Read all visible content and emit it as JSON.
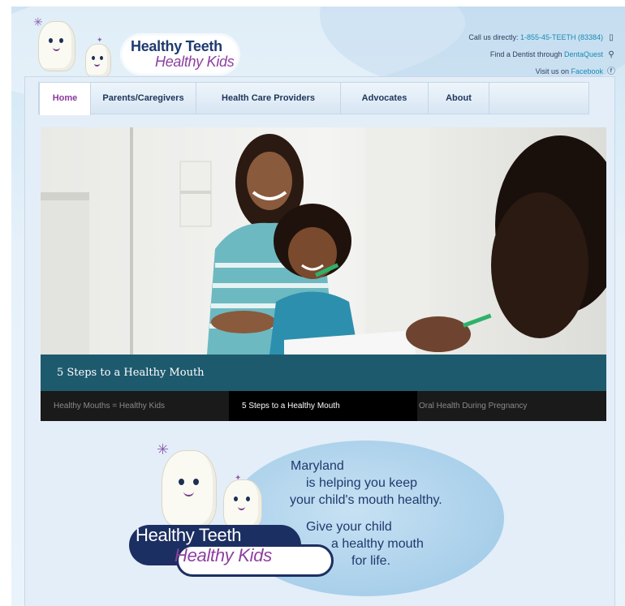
{
  "header": {
    "logo": {
      "line1": "Healthy Teeth",
      "line2": "Healthy Kids"
    },
    "contact": {
      "call_prefix": "Call us directly: ",
      "call_number": "1-855-45-TEETH (83384)",
      "call_icon": "phone-icon",
      "dentist_prefix": "Find a Dentist through ",
      "dentist_link": "DentaQuest",
      "dentist_icon": "map-pin-icon",
      "facebook_prefix": "Visit us on ",
      "facebook_link": "Facebook",
      "facebook_icon": "facebook-icon"
    }
  },
  "nav": {
    "items": [
      {
        "label": "Home",
        "active": true
      },
      {
        "label": "Parents/Caregivers"
      },
      {
        "label": "Health Care Providers"
      },
      {
        "label": "Advocates"
      },
      {
        "label": "About"
      }
    ]
  },
  "hero": {
    "caption": "5 Steps to a Healthy Mouth",
    "tabs": [
      {
        "label": "Healthy Mouths = Healthy Kids"
      },
      {
        "label": "5 Steps to a Healthy Mouth",
        "active": true
      },
      {
        "label": "Oral Health During Pregnancy"
      }
    ]
  },
  "promo": {
    "message": [
      "Maryland",
      "is helping you keep",
      "your child's mouth healthy.",
      "Give your child",
      "a healthy mouth",
      "for life."
    ],
    "logo": {
      "line1": "Healthy Teeth",
      "line2": "Healthy Kids"
    }
  },
  "colors": {
    "accent_purple": "#8e3fa0",
    "navy": "#1f3a6e",
    "link_teal": "#1a8ab4",
    "caption_teal": "#1e5a6e"
  }
}
